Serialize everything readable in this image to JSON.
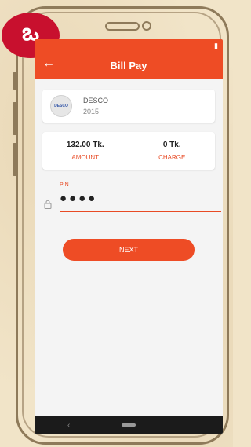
{
  "app": {
    "title": "Bill Pay",
    "back_icon": "arrow-left-icon",
    "accent_color": "#ee4c25"
  },
  "brand": {
    "badge_glyph": "ఒ",
    "badge_color": "#c8102e"
  },
  "biller": {
    "logo_text": "DESCO",
    "name": "DESCO",
    "account": "2015"
  },
  "amounts": {
    "amount_value": "132.00 Tk.",
    "amount_label": "AMOUNT",
    "charge_value": "0 Tk.",
    "charge_label": "CHARGE"
  },
  "pin": {
    "label": "PIN",
    "dots": "●●●●",
    "icon": "lock-icon"
  },
  "actions": {
    "next_label": "NEXT"
  },
  "nav": {
    "back_glyph": "‹"
  }
}
